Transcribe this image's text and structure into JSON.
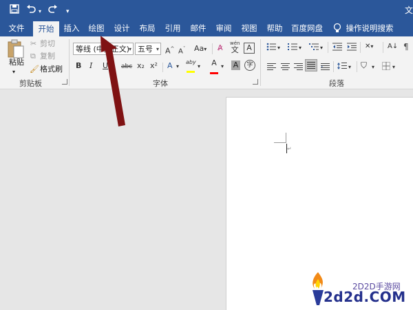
{
  "title_bar": {
    "title": "文"
  },
  "quick_access": {
    "save": "save-icon",
    "undo": "undo-icon",
    "redo": "redo-icon",
    "customize": "customize-icon"
  },
  "tabs": [
    "文件",
    "开始",
    "插入",
    "绘图",
    "设计",
    "布局",
    "引用",
    "邮件",
    "审阅",
    "视图",
    "帮助",
    "百度网盘",
    "操作说明搜索"
  ],
  "active_tab": "开始",
  "clipboard": {
    "paste": "粘贴",
    "cut": "剪切",
    "copy": "复制",
    "format_painter": "格式刷",
    "group_label": "剪贴板"
  },
  "font": {
    "font_name": "等线 (中文正文)",
    "font_size": "五号",
    "bold": "B",
    "italic": "I",
    "underline": "U",
    "strike": "abc",
    "subscript": "x₂",
    "superscript": "x²",
    "grow": "A",
    "shrink": "A",
    "change_case": "Aa",
    "highlight": "aby",
    "font_color": "A",
    "char_shading": "A",
    "enclose": "字",
    "pinyin": "wén",
    "pinyin_char": "文",
    "border_char": "A",
    "group_label": "字体"
  },
  "paragraph": {
    "group_label": "段落"
  },
  "colors": {
    "brand": "#2b579a",
    "highlight_yellow": "#ffff00",
    "font_red": "#ff0000",
    "arrow": "#7f1213"
  },
  "watermark": {
    "top_text": "2D2D手游网",
    "brand": "2d2d.COM"
  }
}
